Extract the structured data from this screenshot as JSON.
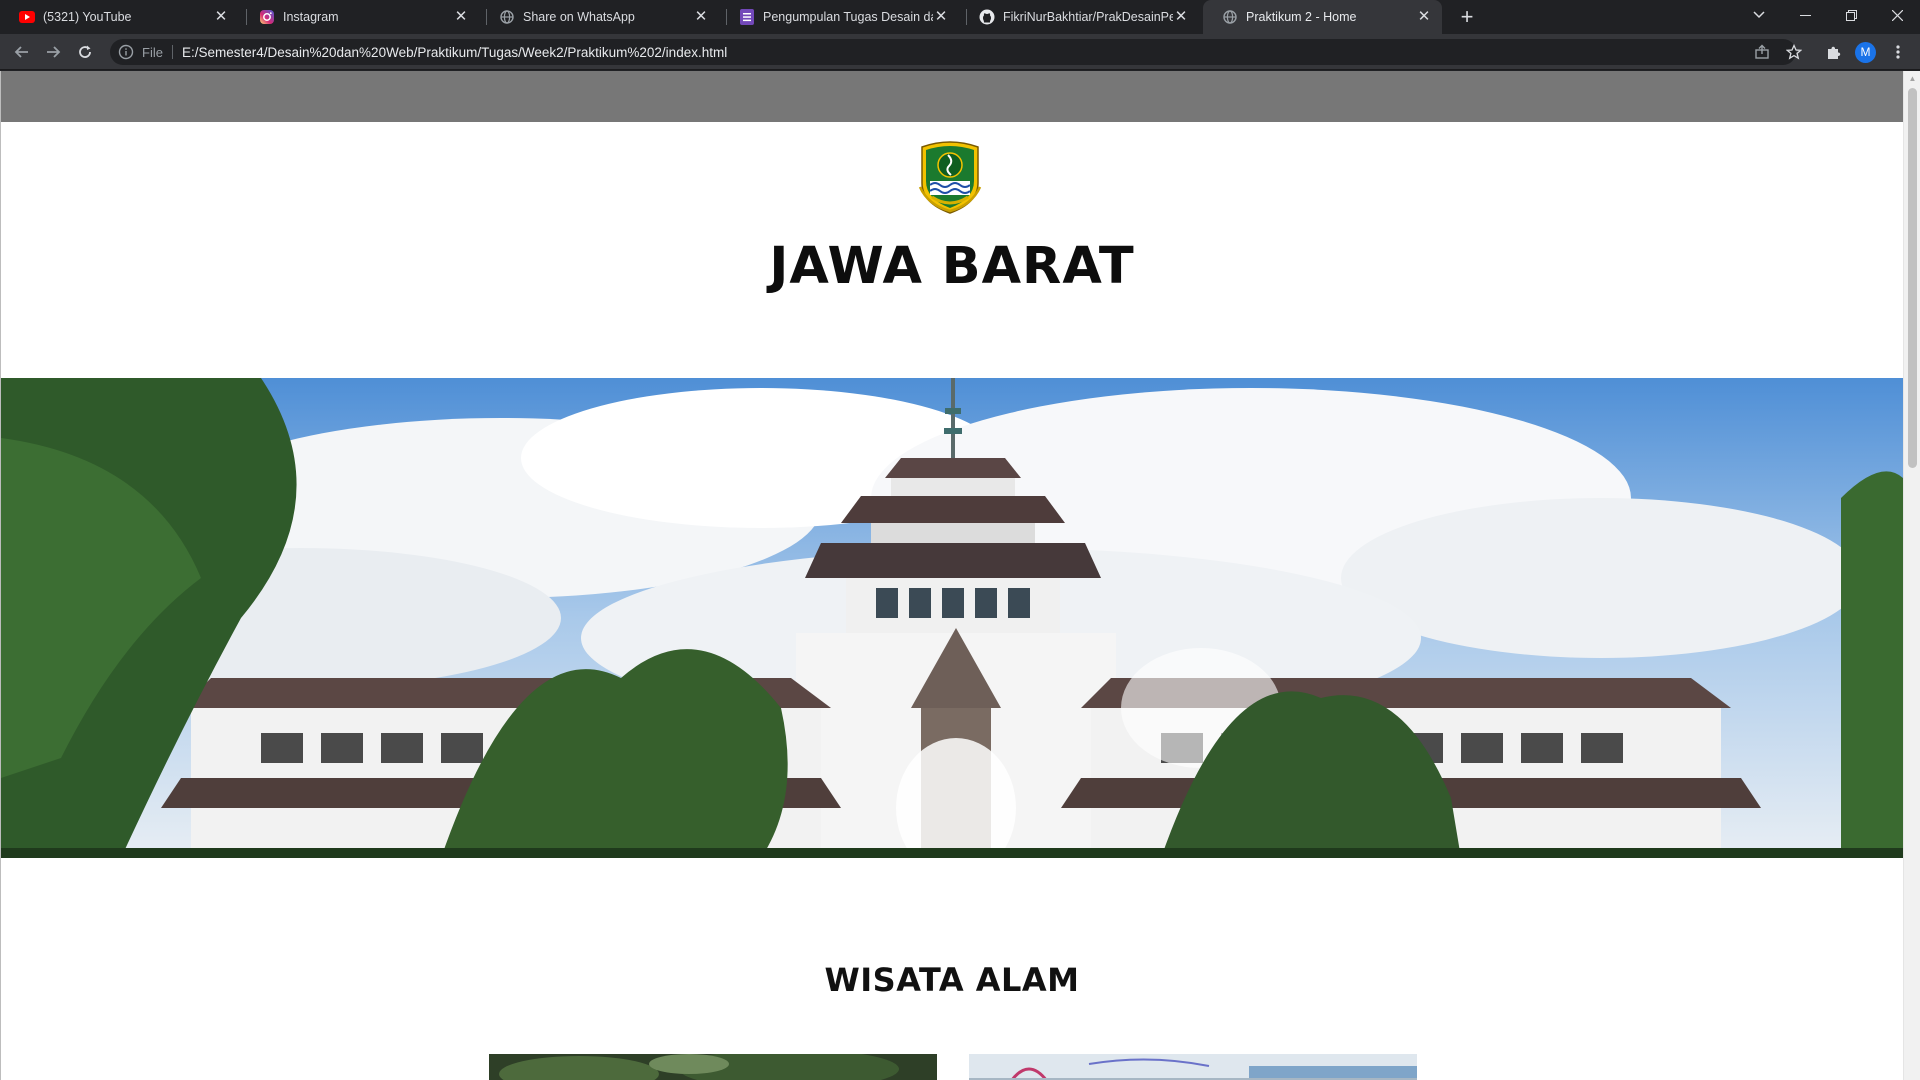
{
  "browser": {
    "tabs": [
      {
        "title": "(5321) YouTube",
        "icon": "youtube-icon",
        "active": false
      },
      {
        "title": "Instagram",
        "icon": "instagram-icon",
        "active": false
      },
      {
        "title": "Share on WhatsApp",
        "icon": "globe-icon",
        "active": false
      },
      {
        "title": "Pengumpulan Tugas Desain dan",
        "icon": "form-icon",
        "active": false
      },
      {
        "title": "FikriNurBakhtiar/PrakDesainPem",
        "icon": "github-icon",
        "active": false
      },
      {
        "title": "Praktikum 2 - Home",
        "icon": "globe-icon",
        "active": true
      }
    ],
    "omnibox": {
      "scheme_label": "File",
      "url": "E:/Semester4/Desain%20dan%20Web/Praktikum/Tugas/Week2/Praktikum%202/index.html"
    },
    "profile_initial": "M"
  },
  "page": {
    "title": "JAWA BARAT",
    "section_title": "WISATA ALAM"
  },
  "colors": {
    "chrome_dark": "#202124",
    "chrome_toolbar": "#35363a",
    "header_bar": "#777777",
    "accent_blue": "#1a73e8"
  }
}
